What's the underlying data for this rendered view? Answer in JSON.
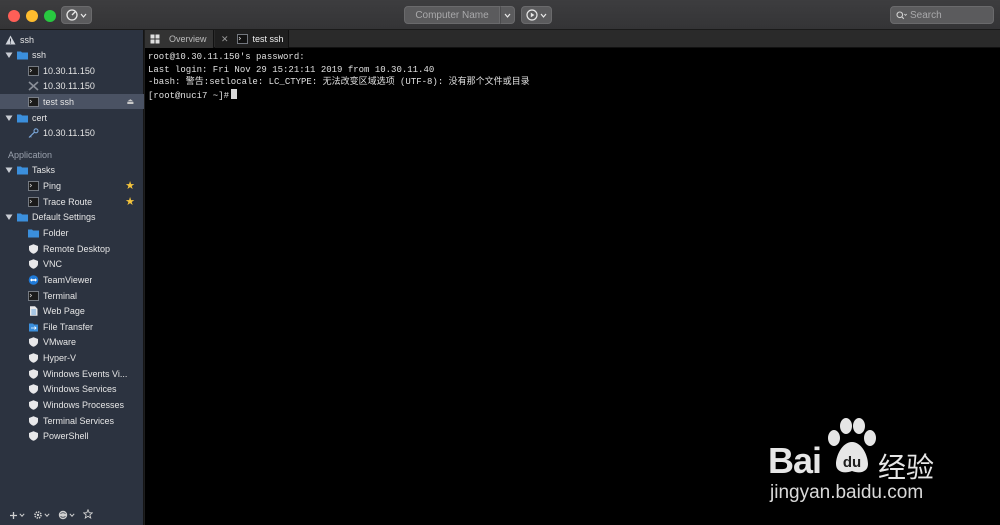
{
  "titlebar": {
    "computer_name_placeholder": "Computer Name",
    "search_placeholder": "Search"
  },
  "sidebar": {
    "root_label": "ssh",
    "ssh_folder": "ssh",
    "ssh_items": [
      "10.30.11.150",
      "10.30.11.150",
      "test ssh"
    ],
    "cert_folder": "cert",
    "cert_items": [
      "10.30.11.150"
    ],
    "application_section": "Application",
    "tasks_folder": "Tasks",
    "tasks_items": [
      "Ping",
      "Trace Route"
    ],
    "defaults_folder": "Default Settings",
    "defaults_items": [
      "Folder",
      "Remote Desktop",
      "VNC",
      "TeamViewer",
      "Terminal",
      "Web Page",
      "File Transfer",
      "VMware",
      "Hyper-V",
      "Windows Events Vi...",
      "Windows Services",
      "Windows Processes",
      "Terminal Services",
      "PowerShell"
    ]
  },
  "tabs": {
    "overview": "Overview",
    "active": "test ssh"
  },
  "terminal": {
    "lines": [
      "root@10.30.11.150's password:",
      "Last login: Fri Nov 29 15:21:11 2019 from 10.30.11.40",
      "-bash: 警告:setlocale: LC_CTYPE: 无法改变区域选项 (UTF-8): 没有那个文件或目录",
      "[root@nuci7 ~]#"
    ]
  },
  "watermark": {
    "brand": "Bai",
    "brand2": "du",
    "cn": "经验",
    "url": "jingyan.baidu.com"
  },
  "colors": {
    "accent_star": "#f5c43c",
    "folder_blue": "#3b8fdc",
    "selected_row": "#4a5263"
  }
}
